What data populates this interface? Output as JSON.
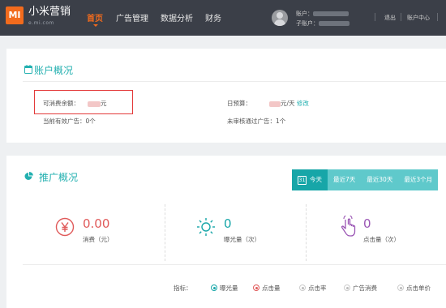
{
  "header": {
    "logo": "MI",
    "brand": "小米营销",
    "brand_sub": "e.mi.com",
    "nav": [
      "首页",
      "广告管理",
      "数据分析",
      "财务"
    ],
    "account_label": "账户：",
    "subaccount_label": "子账户：",
    "logout": "退出",
    "account_center": "账户中心"
  },
  "account_overview": {
    "title": "账户概况",
    "balance_label": "可消费余额：",
    "balance_unit": "元",
    "daily_budget_label": "日预算：",
    "daily_budget_unit": "元/天",
    "modify": "修改",
    "active_ads": "当前有效广告：0个",
    "pending_ads": "未审核通过广告：1个"
  },
  "promotion_overview": {
    "title": "推广概况",
    "date_icon_day": "31",
    "tabs": [
      "今天",
      "最近7天",
      "最近30天",
      "最近3个月"
    ],
    "active_tab": "今天",
    "stats": [
      {
        "value": "0.00",
        "label": "消费（元）",
        "color": "#e05a5a",
        "icon": "yen-icon"
      },
      {
        "value": "0",
        "label": "曝光量（次）",
        "color": "#17a6a8",
        "icon": "sun-icon"
      },
      {
        "value": "0",
        "label": "点击量（次）",
        "color": "#9a55b4",
        "icon": "hand-pointer-icon"
      }
    ],
    "metric_label": "指标：",
    "metrics": [
      "曝光量",
      "点击量",
      "点击率",
      "广告消费",
      "点击单价"
    ]
  }
}
